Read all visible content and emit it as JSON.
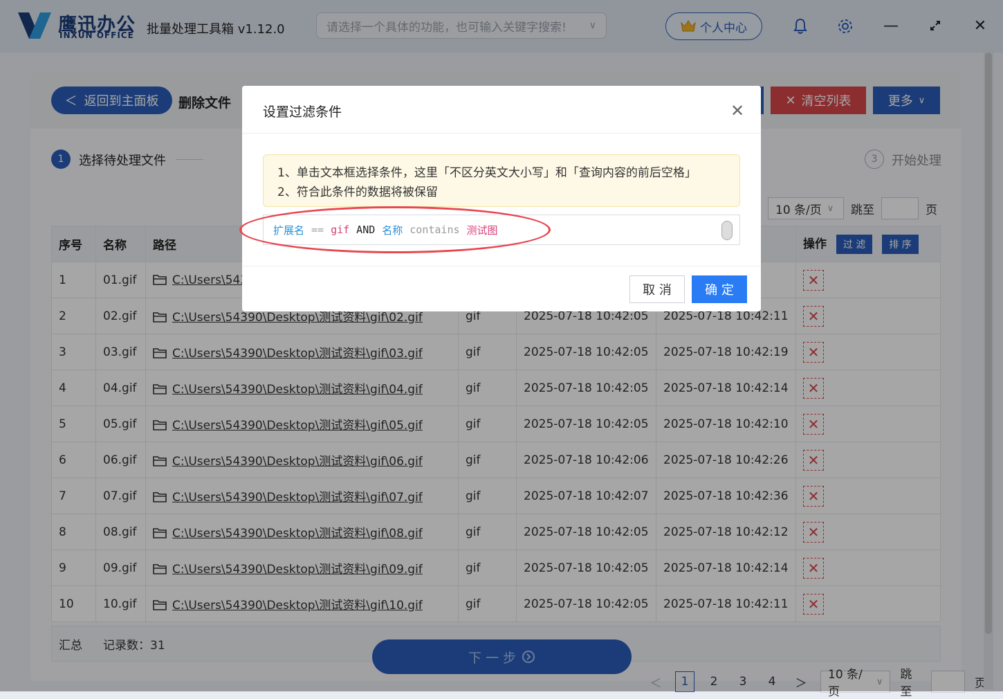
{
  "titlebar": {
    "brand": "鹰迅办公",
    "brand_en": "INXUN OFFICE",
    "app_title": "批量处理工具箱 v1.12.0",
    "search_placeholder": "请选择一个具体的功能，也可输入关键字搜索!",
    "user_center": "个人中心"
  },
  "header": {
    "back_label": "返回到主面板",
    "page_title": "删除文件",
    "clear_label": "清空列表",
    "more_label": "更多"
  },
  "steps": {
    "step1_num": "1",
    "step1_label": "选择待处理文件",
    "step3_num": "3",
    "step3_label": "开始处理"
  },
  "pager": {
    "per_page": "10 条/页",
    "jump_label": "跳至",
    "page_unit": "页",
    "pages": [
      "1",
      "2",
      "3",
      "4"
    ]
  },
  "table": {
    "headers": {
      "index": "序号",
      "name": "名称",
      "path": "路径",
      "ext": "",
      "created": "",
      "modified": "",
      "action": "操作"
    },
    "filter_btn": "过 滤",
    "sort_btn": "排 序",
    "rows": [
      {
        "idx": "1",
        "name": "01.gif",
        "path": "C:\\Users\\543",
        "ext": "",
        "created": "",
        "modified": "28"
      },
      {
        "idx": "2",
        "name": "02.gif",
        "path": "C:\\Users\\54390\\Desktop\\测试资料\\gif\\02.gif",
        "ext": "gif",
        "created": "2025-07-18 10:42:05",
        "modified": "2025-07-18 10:42:11"
      },
      {
        "idx": "3",
        "name": "03.gif",
        "path": "C:\\Users\\54390\\Desktop\\测试资料\\gif\\03.gif",
        "ext": "gif",
        "created": "2025-07-18 10:42:05",
        "modified": "2025-07-18 10:42:19"
      },
      {
        "idx": "4",
        "name": "04.gif",
        "path": "C:\\Users\\54390\\Desktop\\测试资料\\gif\\04.gif",
        "ext": "gif",
        "created": "2025-07-18 10:42:05",
        "modified": "2025-07-18 10:42:14"
      },
      {
        "idx": "5",
        "name": "05.gif",
        "path": "C:\\Users\\54390\\Desktop\\测试资料\\gif\\05.gif",
        "ext": "gif",
        "created": "2025-07-18 10:42:05",
        "modified": "2025-07-18 10:42:10"
      },
      {
        "idx": "6",
        "name": "06.gif",
        "path": "C:\\Users\\54390\\Desktop\\测试资料\\gif\\06.gif",
        "ext": "gif",
        "created": "2025-07-18 10:42:06",
        "modified": "2025-07-18 10:42:26"
      },
      {
        "idx": "7",
        "name": "07.gif",
        "path": "C:\\Users\\54390\\Desktop\\测试资料\\gif\\07.gif",
        "ext": "gif",
        "created": "2025-07-18 10:42:07",
        "modified": "2025-07-18 10:42:36"
      },
      {
        "idx": "8",
        "name": "08.gif",
        "path": "C:\\Users\\54390\\Desktop\\测试资料\\gif\\08.gif",
        "ext": "gif",
        "created": "2025-07-18 10:42:05",
        "modified": "2025-07-18 10:42:12"
      },
      {
        "idx": "9",
        "name": "09.gif",
        "path": "C:\\Users\\54390\\Desktop\\测试资料\\gif\\09.gif",
        "ext": "gif",
        "created": "2025-07-18 10:42:05",
        "modified": "2025-07-18 10:42:14"
      },
      {
        "idx": "10",
        "name": "10.gif",
        "path": "C:\\Users\\54390\\Desktop\\测试资料\\gif\\10.gif",
        "ext": "gif",
        "created": "2025-07-18 10:42:05",
        "modified": "2025-07-18 10:42:11"
      }
    ],
    "summary_label": "汇总",
    "record_count": "记录数：31"
  },
  "next_label": "下 一 步",
  "modal": {
    "title": "设置过滤条件",
    "tip_line1": "1、单击文本框选择条件，这里「不区分英文大小写」和「查询内容的前后空格」",
    "tip_line2": "2、符合此条件的数据将被保留",
    "expr": {
      "field1": "扩展名",
      "op1": "==",
      "val1": "gif",
      "kw": "AND",
      "field2": "名称",
      "op2": "contains",
      "val2": "测试图"
    },
    "cancel_label": "取 消",
    "ok_label": "确 定"
  },
  "colors": {
    "primary": "#2a5cb8",
    "danger": "#d7464a",
    "confirm": "#2a7cf5",
    "highlight_ellipse": "#e8474f"
  },
  "icons": [
    "logo-x-icon",
    "crown-icon",
    "bell-icon",
    "gear-icon",
    "minimize-icon",
    "restore-icon",
    "close-icon",
    "chevron-left-icon",
    "x-icon",
    "chevron-down-icon",
    "folder-icon",
    "next-circle-icon",
    "chevron-right-icon"
  ]
}
